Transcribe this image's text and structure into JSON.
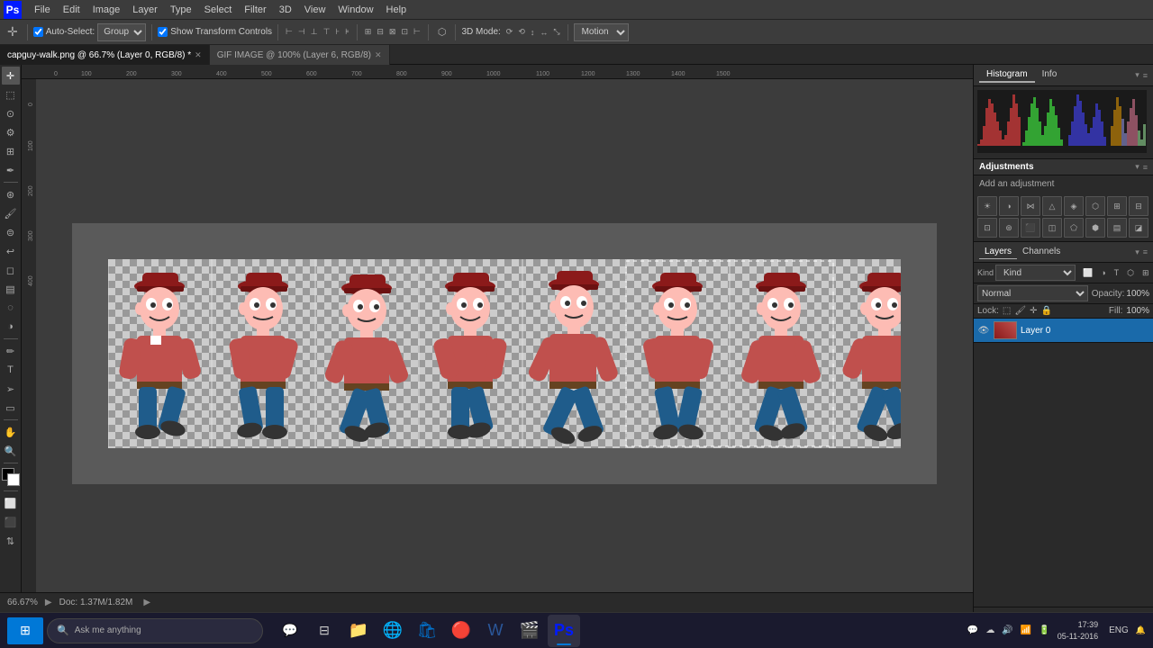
{
  "app": {
    "title": "Adobe Photoshop",
    "logo": "Ps",
    "logo_bg": "#001aff"
  },
  "menubar": {
    "items": [
      "File",
      "Edit",
      "Image",
      "Layer",
      "Type",
      "Select",
      "Filter",
      "3D",
      "View",
      "Window",
      "Help"
    ]
  },
  "toolbar": {
    "auto_select_label": "Auto-Select:",
    "group_label": "Group",
    "show_transform_label": "Show Transform Controls",
    "three_d_mode_label": "3D Mode:",
    "motion_label": "Motion"
  },
  "tabs": [
    {
      "label": "capguy-walk.png @ 66.7% (Layer 0, RGB/8)",
      "active": true,
      "modified": true
    },
    {
      "label": "GIF IMAGE @ 100% (Layer 6, RGB/8)",
      "active": false,
      "modified": false
    }
  ],
  "histogram_panel": {
    "tabs": [
      "Histogram",
      "Info"
    ],
    "active_tab": "Histogram"
  },
  "adjustments_panel": {
    "title": "Adjustments",
    "subtitle": "Add an adjustment",
    "icons": [
      "☀",
      "◑",
      "◈",
      "▲",
      "⬛",
      "⬡",
      "◧",
      "⧈",
      "◉",
      "⬤",
      "✦",
      "▣",
      "⬠",
      "⬢",
      "◪",
      "⊞",
      "⊠",
      "◫",
      "⬛",
      "⬥",
      "▣",
      "⊡",
      "◓",
      "⊠"
    ]
  },
  "layers_panel": {
    "title": "Layers",
    "tabs": [
      "Layers",
      "Channels"
    ],
    "active_tab": "Layers",
    "blend_mode": "Normal",
    "opacity": "100%",
    "fill": "100%",
    "lock_label": "Lock:",
    "kind_label": "Kind",
    "layers": [
      {
        "name": "Layer 0",
        "visible": true,
        "active": true
      }
    ]
  },
  "statusbar": {
    "zoom": "66.67%",
    "doc_info": "Doc: 1.37M/1.82M"
  },
  "taskbar": {
    "search_placeholder": "Ask me anything",
    "time": "17:39",
    "date": "05-11-2016",
    "language": "ENG",
    "apps": [
      {
        "icon": "🪟",
        "label": "windows-start",
        "color": "#0078d7"
      },
      {
        "icon": "⊞",
        "label": "task-view"
      },
      {
        "icon": "🔍",
        "label": "search"
      },
      {
        "icon": "📁",
        "label": "file-explorer"
      },
      {
        "icon": "🌐",
        "label": "edge-browser"
      },
      {
        "icon": "⬡",
        "label": "store"
      },
      {
        "icon": "🔴",
        "label": "chrome"
      },
      {
        "icon": "📝",
        "label": "word"
      },
      {
        "icon": "🎬",
        "label": "media"
      },
      {
        "icon": "🎨",
        "label": "photoshop",
        "active": true
      }
    ]
  }
}
